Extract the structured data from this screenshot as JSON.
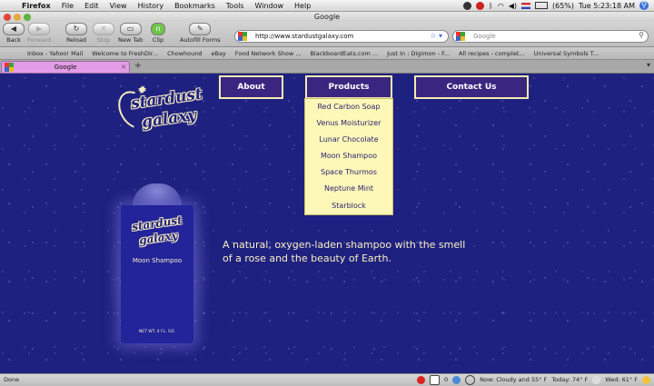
{
  "menubar": {
    "app": "Firefox",
    "items": [
      "File",
      "Edit",
      "View",
      "History",
      "Bookmarks",
      "Tools",
      "Window",
      "Help"
    ],
    "battery": "(65%)",
    "clock": "Tue 5:23:18 AM"
  },
  "window": {
    "title": "Google"
  },
  "toolbar": {
    "back": "Back",
    "forward": "Forward",
    "reload": "Reload",
    "stop": "Stop",
    "new_tab": "New Tab",
    "clip": "Clip",
    "autofill": "Autofill Forms",
    "url": "http://www.stardustgalaxy.com",
    "search_placeholder": "Google"
  },
  "bookmarks": [
    "Inbox - Yahoo! Mail",
    "Welcome to FreshDir...",
    "Chowhound",
    "eBay",
    "Food Network Show ...",
    "BlackboardEats.com ...",
    "Just In : Digimon - F...",
    "All recipes - complet...",
    "Universal Symbols T..."
  ],
  "tab": {
    "label": "Google"
  },
  "site": {
    "logo_line1": "stardust",
    "logo_line2": "galaxy",
    "nav": {
      "about": "About",
      "products": "Products",
      "contact": "Contact Us"
    },
    "products": [
      "Red Carbon Soap",
      "Venus Moisturizer",
      "Lunar Chocolate",
      "Moon Shampoo",
      "Space Thurmos",
      "Neptune Mint",
      "Starblock"
    ],
    "bottle_name": "Moon Shampoo",
    "bottle_net": "NET WT. 4 FL. OZ.",
    "tagline": "A natural, oxygen-laden shampoo with the smell of a rose and the beauty of Earth."
  },
  "statusbar": {
    "status": "Done",
    "mail_count": "0",
    "now": "Now: Cloudy and 55° F",
    "today": "Today: 74° F",
    "wed": "Wed: 61° F"
  },
  "colors": {
    "page_bg": "#1f2180",
    "nav_bg": "#3a2680",
    "nav_border": "#f3eab0",
    "dropdown_bg": "#fdf7b8",
    "tab_active": "#e39ce6"
  }
}
